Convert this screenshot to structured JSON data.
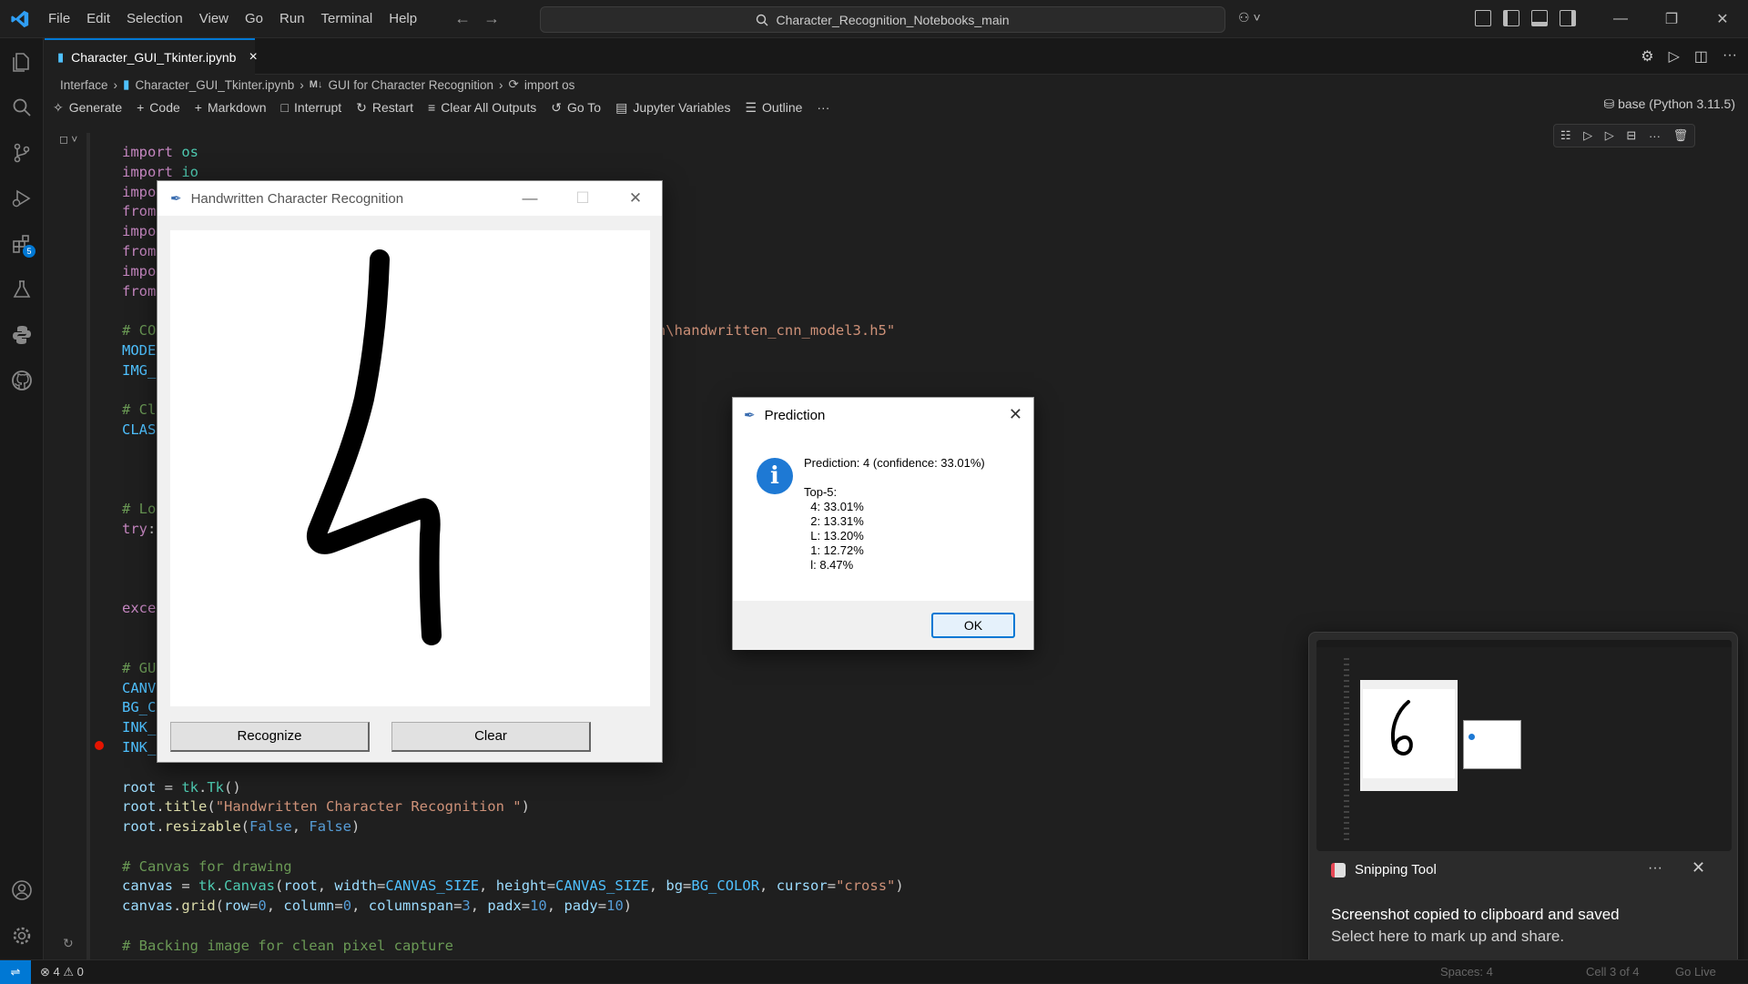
{
  "titlebar": {
    "menus": [
      "File",
      "Edit",
      "Selection",
      "View",
      "Go",
      "Run",
      "Terminal",
      "Help"
    ],
    "search_text": "Character_Recognition_Notebooks_main"
  },
  "tabs": [
    {
      "label": "Character_GUI_Tkinter.ipynb",
      "close": "×"
    }
  ],
  "breadcrumb": {
    "folder": "Interface",
    "file": "Character_GUI_Tkinter.ipynb",
    "md_badge": "M↓",
    "section": "GUI for Character Recognition",
    "cell": "import os"
  },
  "toolbar": {
    "generate": "Generate",
    "code": "Code",
    "markdown": "Markdown",
    "interrupt": "Interrupt",
    "restart": "Restart",
    "clear_outputs": "Clear All Outputs",
    "goto": "Go To",
    "variables": "Jupyter Variables",
    "outline": "Outline",
    "more": "···",
    "kernel": "base (Python 3.11.5)"
  },
  "activity_badge": "5",
  "tk_window": {
    "title": "Handwritten Character Recognition",
    "recognize": "Recognize",
    "clear": "Clear"
  },
  "dialog": {
    "title": "Prediction",
    "message": "Prediction: 4 (confidence: 33.01%)\n\nTop-5:\n  4: 33.01%\n  2: 13.31%\n  L: 13.20%\n  1: 12.72%\n  l: 8.47%",
    "ok": "OK"
  },
  "toast": {
    "app": "Snipping Tool",
    "more": "···",
    "message": "Screenshot copied to clipboard and saved",
    "sub": "Select here to mark up and share."
  },
  "status": {
    "problems": "⊗ 4 ⚠ 0",
    "spaces": "Spaces: 4",
    "cell": "Cell 3 of 4",
    "golive": "Go Live"
  },
  "colors": {
    "accent": "#0078d4",
    "editor_bg": "#1f1f1f",
    "info_blue": "#1e79d4"
  }
}
